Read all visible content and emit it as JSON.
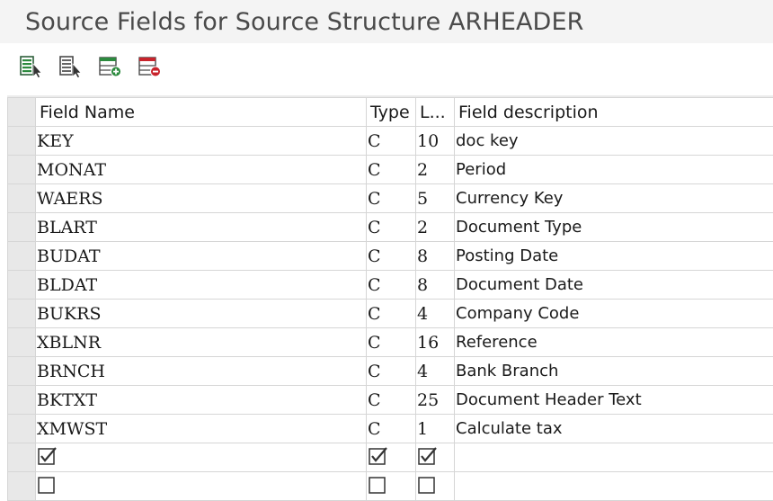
{
  "window": {
    "title": "Source Fields for Source Structure ARHEADER"
  },
  "toolbar": {
    "buttons": [
      {
        "name": "select-all-icon"
      },
      {
        "name": "deselect-all-icon"
      },
      {
        "name": "insert-row-icon"
      },
      {
        "name": "delete-row-icon"
      }
    ]
  },
  "table": {
    "headers": {
      "field_name": "Field Name",
      "type": "Type",
      "length": "L...",
      "description": "Field description"
    },
    "rows": [
      {
        "name": "KEY",
        "type": "C",
        "length": "10",
        "desc": "doc key"
      },
      {
        "name": "MONAT",
        "type": "C",
        "length": "2",
        "desc": "Period"
      },
      {
        "name": "WAERS",
        "type": "C",
        "length": "5",
        "desc": "Currency Key"
      },
      {
        "name": "BLART",
        "type": "C",
        "length": "2",
        "desc": "Document Type"
      },
      {
        "name": "BUDAT",
        "type": "C",
        "length": "8",
        "desc": "Posting Date"
      },
      {
        "name": "BLDAT",
        "type": "C",
        "length": "8",
        "desc": "Document Date"
      },
      {
        "name": "BUKRS",
        "type": "C",
        "length": "4",
        "desc": "Company Code"
      },
      {
        "name": "XBLNR",
        "type": "C",
        "length": "16",
        "desc": "Reference"
      },
      {
        "name": "BRNCH",
        "type": "C",
        "length": "4",
        "desc": "Bank Branch"
      },
      {
        "name": "BKTXT",
        "type": "C",
        "length": "25",
        "desc": "Document Header Text"
      },
      {
        "name": "XMWST",
        "type": "C",
        "length": "1",
        "desc": "Calculate tax"
      }
    ]
  }
}
